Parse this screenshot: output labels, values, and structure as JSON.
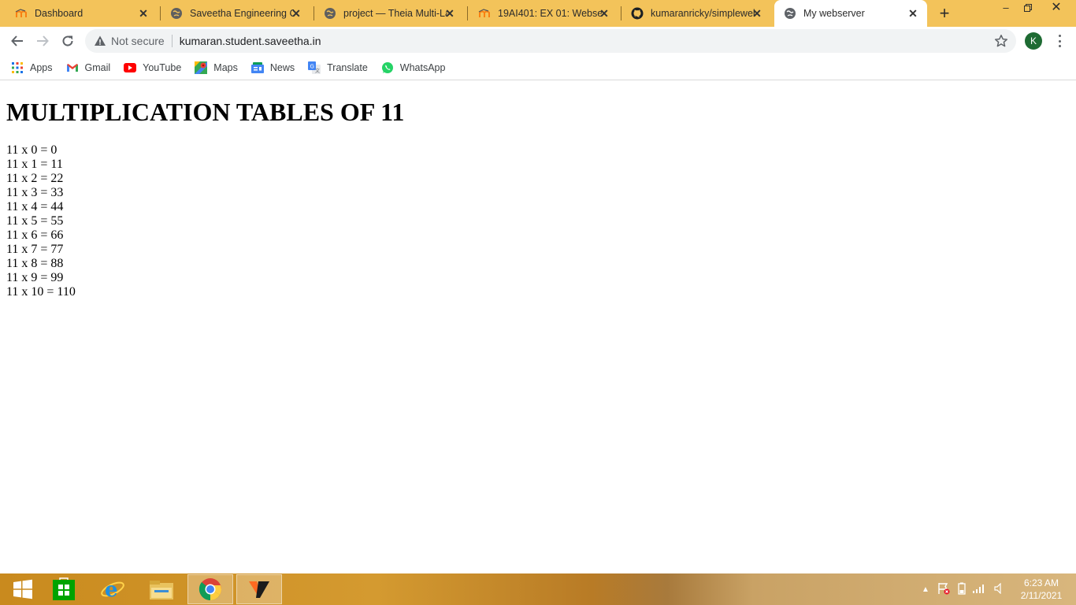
{
  "browser": {
    "tabs": [
      {
        "title": "Dashboard",
        "favicon": "moodle-icon"
      },
      {
        "title": "Saveetha Engineering Co",
        "favicon": "globe-icon"
      },
      {
        "title": "project — Theia Multi-La",
        "favicon": "globe-icon"
      },
      {
        "title": "19AI401: EX 01: Webserv",
        "favicon": "moodle-icon"
      },
      {
        "title": "kumaranricky/simpleweb",
        "favicon": "github-icon"
      },
      {
        "title": "My webserver",
        "favicon": "globe-icon",
        "active": true
      }
    ],
    "omnibox": {
      "security_label": "Not secure",
      "url": "kumaran.student.saveetha.in"
    },
    "profile_initial": "K"
  },
  "bookmarks": [
    {
      "label": "Apps",
      "icon": "apps-grid-icon"
    },
    {
      "label": "Gmail",
      "icon": "gmail-icon"
    },
    {
      "label": "YouTube",
      "icon": "youtube-icon"
    },
    {
      "label": "Maps",
      "icon": "maps-icon"
    },
    {
      "label": "News",
      "icon": "news-icon"
    },
    {
      "label": "Translate",
      "icon": "translate-icon"
    },
    {
      "label": "WhatsApp",
      "icon": "whatsapp-icon"
    }
  ],
  "page": {
    "heading": "MULTIPLICATION TABLES OF 11",
    "rows": [
      "11 x 0 = 0",
      "11 x 1 = 11",
      "11 x 2 = 22",
      "11 x 3 = 33",
      "11 x 4 = 44",
      "11 x 5 = 55",
      "11 x 6 = 66",
      "11 x 7 = 77",
      "11 x 8 = 88",
      "11 x 9 = 99",
      "11 x 10 = 110"
    ]
  },
  "taskbar": {
    "items": [
      "windows-start-icon",
      "store-icon",
      "internet-explorer-icon",
      "file-explorer-icon",
      "chrome-icon",
      "app-v-icon"
    ],
    "time": "6:23 AM",
    "date": "2/11/2021"
  },
  "colors": {
    "tabstrip": "#f3c35a",
    "omnibox": "#f1f3f4",
    "profile": "#1e6b33"
  }
}
